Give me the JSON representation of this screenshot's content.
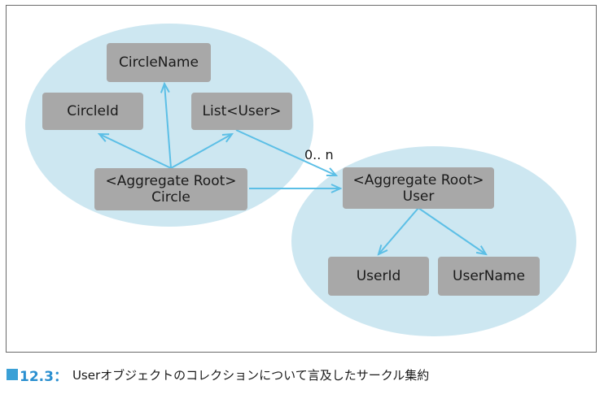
{
  "diagram": {
    "nodes": {
      "circle_name": "CircleName",
      "circle_id": "CircleId",
      "list_user": "List<User>",
      "circle_root": "<Aggregate Root>\nCircle",
      "user_root": "<Aggregate Root>\nUser",
      "user_id": "UserId",
      "user_name": "UserName"
    },
    "multiplicity": "0.. n",
    "colors": {
      "aggregate_fill": "#cde7f1",
      "node_fill": "#a8a8a8",
      "arrow": "#5cbfe6",
      "caption_accent": "#2a8fd0"
    }
  },
  "caption": {
    "icon": "figure-icon",
    "number": "12.3：",
    "text": "Userオブジェクトのコレクションについて言及したサークル集約"
  }
}
